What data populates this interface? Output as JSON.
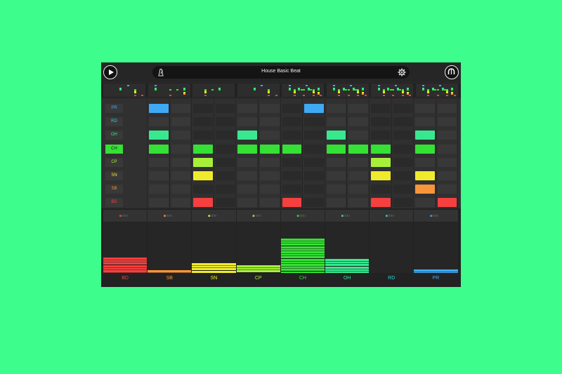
{
  "pattern_title": "House Basic Beat",
  "tracks": [
    {
      "name": "PR",
      "color": "#3fa9f5",
      "volume": 0.07,
      "steps": [
        2,
        9
      ]
    },
    {
      "name": "RD",
      "color": "#2fd6d6",
      "volume": 0.0,
      "steps": []
    },
    {
      "name": "OH",
      "color": "#38e88f",
      "volume": 0.28,
      "steps": [
        2,
        6,
        10,
        14
      ]
    },
    {
      "name": "CH",
      "color": "#34e134",
      "volume": 0.68,
      "steps": [
        2,
        4,
        6,
        7,
        8,
        10,
        11,
        12,
        14
      ]
    },
    {
      "name": "CP",
      "color": "#a6f03a",
      "volume": 0.15,
      "steps": [
        4,
        12
      ]
    },
    {
      "name": "SN",
      "color": "#f0ea2c",
      "volume": 0.2,
      "steps": [
        4,
        12,
        14
      ]
    },
    {
      "name": "SB",
      "color": "#f7953a",
      "volume": 0.06,
      "steps": [
        14
      ]
    },
    {
      "name": "BD",
      "color": "#f5403f",
      "volume": 0.3,
      "steps": [
        4,
        8,
        12,
        15
      ]
    }
  ],
  "mixer_order": [
    "BD",
    "SB",
    "SN",
    "CP",
    "CH",
    "OH",
    "RD",
    "PR"
  ],
  "selected_row": "CH",
  "icons": {
    "play": "play-icon",
    "metronome": "metronome-icon",
    "settings": "gear-icon",
    "profile": "headphones-icon"
  }
}
